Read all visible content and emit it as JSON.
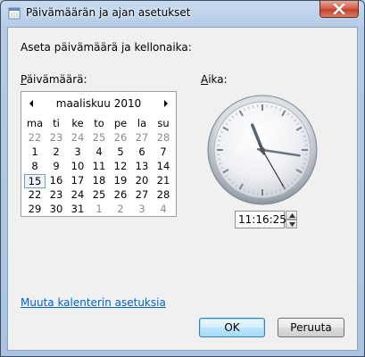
{
  "window": {
    "title": "Päivämäärän ja ajan asetukset"
  },
  "instruction": "Aseta päivämäärä ja kellonaika:",
  "date_label": {
    "underlined": "P",
    "rest": "äivämäärä:"
  },
  "time_label": {
    "underlined": "A",
    "rest": "ika:"
  },
  "calendar": {
    "month_year": "maaliskuu 2010",
    "weekdays": [
      "ma",
      "ti",
      "ke",
      "to",
      "pe",
      "la",
      "su"
    ],
    "weeks": [
      [
        "22",
        "23",
        "24",
        "25",
        "26",
        "27",
        "28"
      ],
      [
        "1",
        "2",
        "3",
        "4",
        "5",
        "6",
        "7"
      ],
      [
        "8",
        "9",
        "10",
        "11",
        "12",
        "13",
        "14"
      ],
      [
        "15",
        "16",
        "17",
        "18",
        "19",
        "20",
        "21"
      ],
      [
        "22",
        "23",
        "24",
        "25",
        "26",
        "27",
        "28"
      ],
      [
        "29",
        "30",
        "31",
        "1",
        "2",
        "3",
        "4"
      ]
    ],
    "selected_day": "15"
  },
  "clock": {
    "hours": 11,
    "minutes": 16,
    "seconds": 25
  },
  "time_value": "11:16:25",
  "link_text": "Muuta kalenterin asetuksia",
  "buttons": {
    "ok": "OK",
    "cancel": "Peruuta"
  }
}
